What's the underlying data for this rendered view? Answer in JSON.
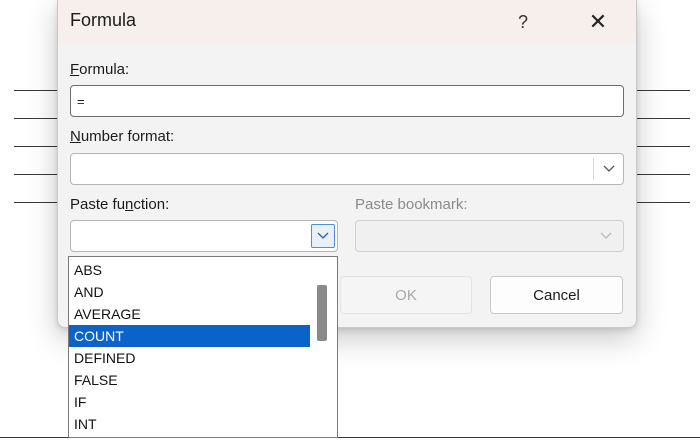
{
  "dialog": {
    "title": "Formula",
    "help_glyph": "?",
    "close_glyph": "✕",
    "formula": {
      "label_first": "F",
      "label_rest": "ormula:",
      "value": "="
    },
    "number_format": {
      "label_first": "N",
      "label_rest": "umber format:",
      "value": ""
    },
    "paste_function": {
      "label_pre": "Paste fu",
      "label_ul": "n",
      "label_post": "ction:",
      "value": "",
      "options": [
        "ABS",
        "AND",
        "AVERAGE",
        "COUNT",
        "DEFINED",
        "FALSE",
        "IF",
        "INT"
      ],
      "highlighted": "COUNT"
    },
    "paste_bookmark": {
      "label": "Paste bookmark:",
      "value": ""
    },
    "ok_label": "OK",
    "cancel_label": "Cancel",
    "icons": {
      "help": "help-icon",
      "close": "close-icon",
      "dropdown": "chevron-down-icon"
    }
  }
}
